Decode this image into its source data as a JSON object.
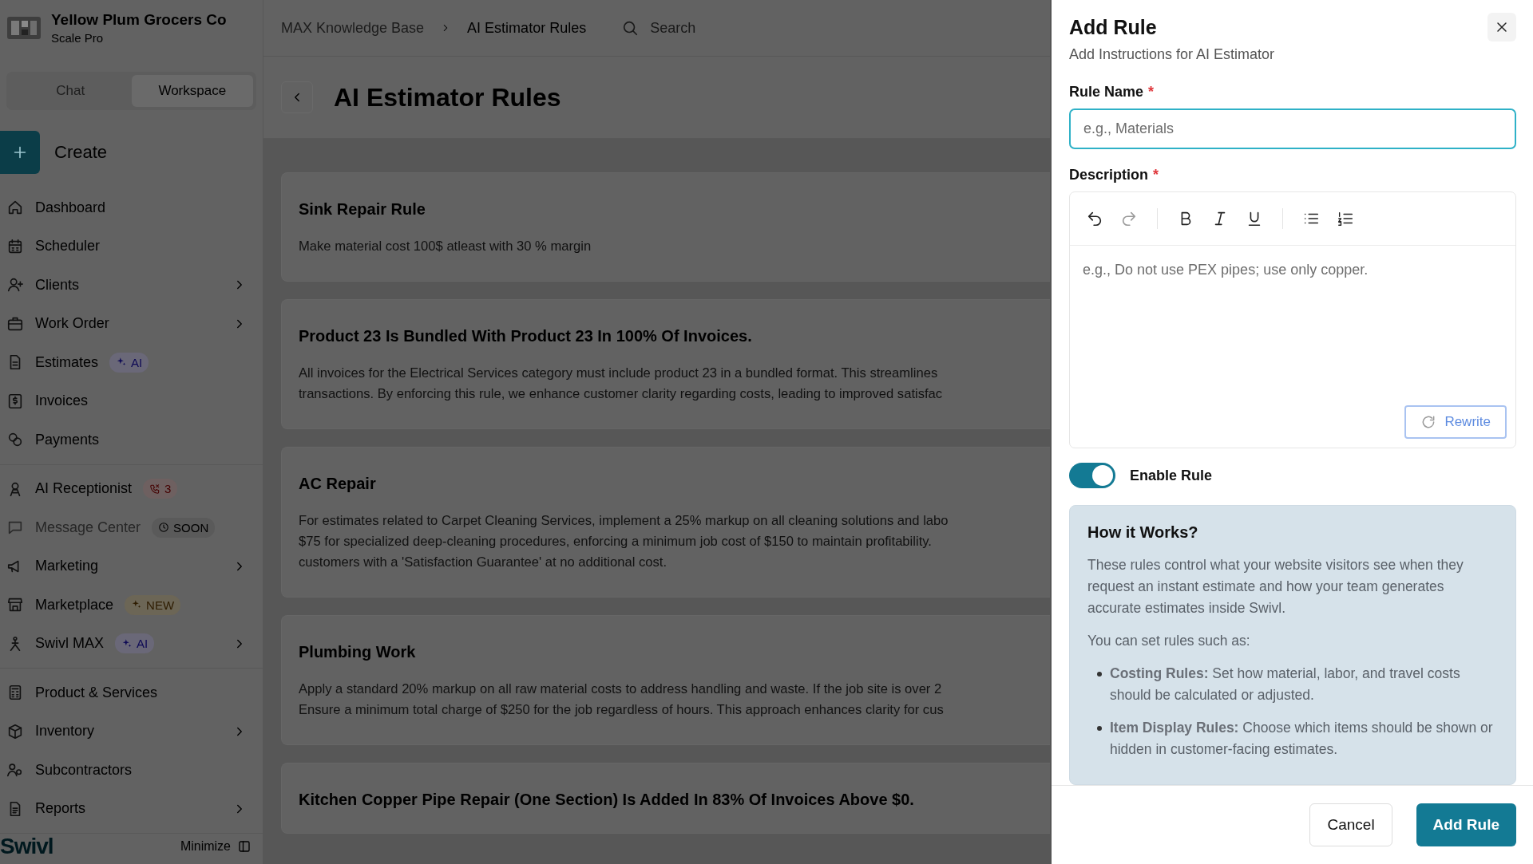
{
  "company": {
    "name": "Yellow Plum Grocers Co",
    "plan": "Scale Pro"
  },
  "mode_tabs": [
    {
      "label": "Chat",
      "selected": false
    },
    {
      "label": "Workspace",
      "selected": true
    }
  ],
  "create_button": {
    "label": "Create"
  },
  "nav_sections": [
    {
      "items": [
        {
          "label": "Dashboard",
          "has_submenu": false,
          "disabled": false
        },
        {
          "label": "Scheduler",
          "has_submenu": false,
          "disabled": false
        },
        {
          "label": "Clients",
          "has_submenu": true,
          "disabled": false
        },
        {
          "label": "Work Order",
          "has_submenu": true,
          "disabled": false
        },
        {
          "label": "Estimates",
          "has_submenu": false,
          "disabled": false,
          "badge": {
            "kind": "ai",
            "text": "AI"
          }
        },
        {
          "label": "Invoices",
          "has_submenu": false,
          "disabled": false
        },
        {
          "label": "Payments",
          "has_submenu": false,
          "disabled": false
        }
      ]
    },
    {
      "items": [
        {
          "label": "AI Receptionist",
          "has_submenu": false,
          "disabled": false,
          "badge": {
            "kind": "calls",
            "text": "3"
          }
        },
        {
          "label": "Message Center",
          "has_submenu": false,
          "disabled": true,
          "badge": {
            "kind": "soon",
            "text": "SOON"
          }
        },
        {
          "label": "Marketing",
          "has_submenu": true,
          "disabled": false
        },
        {
          "label": "Marketplace",
          "has_submenu": false,
          "disabled": false,
          "badge": {
            "kind": "new",
            "text": "NEW"
          }
        },
        {
          "label": "Swivl MAX",
          "has_submenu": true,
          "disabled": false,
          "badge": {
            "kind": "ai",
            "text": "AI"
          }
        }
      ]
    },
    {
      "items": [
        {
          "label": "Product & Services",
          "has_submenu": false,
          "disabled": false
        },
        {
          "label": "Inventory",
          "has_submenu": true,
          "disabled": false
        },
        {
          "label": "Subcontractors",
          "has_submenu": false,
          "disabled": false
        },
        {
          "label": "Reports",
          "has_submenu": true,
          "disabled": false
        }
      ]
    }
  ],
  "sidebar_footer": {
    "logo": "Swivl",
    "minimize": "Minimize"
  },
  "breadcrumbs": [
    "MAX Knowledge Base",
    "AI Estimator Rules"
  ],
  "search": {
    "placeholder": "Search"
  },
  "page_title": "AI Estimator Rules",
  "rules": [
    {
      "title": "Sink Repair Rule",
      "lines": [
        "Make material cost 100$ atleast with 30 % margin"
      ]
    },
    {
      "title": "Product 23 Is Bundled With Product 23 In 100% Of Invoices.",
      "lines": [
        "All invoices for the Electrical Services category must include product 23 in a bundled format. This streamlines",
        "transactions. By enforcing this rule, we enhance customer clarity regarding costs, leading to improved satisfac"
      ]
    },
    {
      "title": "AC Repair",
      "lines": [
        "For estimates related to Carpet Cleaning Services, implement a 25% markup on all cleaning solutions and labo",
        "$75 for specialized deep-cleaning procedures, enforcing a minimum job cost of $150 to maintain profitability.",
        "customers with a 'Satisfaction Guarantee' at no additional cost."
      ]
    },
    {
      "title": "Plumbing Work",
      "lines": [
        "Apply a standard 20% markup on all raw material costs to address handling and waste. If the job site is over 2",
        "Ensure a minimum total charge of $250 for the job regardless of hours. This approach enhances clarity for cus"
      ]
    },
    {
      "title": "Kitchen Copper Pipe Repair (One Section) Is Added In 83% Of Invoices Above $0."
    }
  ],
  "drawer": {
    "title": "Add Rule",
    "subtitle": "Add Instructions for AI Estimator",
    "rule_name": {
      "label": "Rule Name",
      "required_mark": "*",
      "placeholder": "e.g., Materials",
      "focused": true
    },
    "description": {
      "label": "Description",
      "required_mark": "*",
      "placeholder": "e.g., Do not use PEX pipes; use only copper.",
      "toolbar_groups": [
        [
          {
            "kind": "undo",
            "disabled": false
          },
          {
            "kind": "redo",
            "disabled": true
          }
        ],
        [
          {
            "kind": "bold",
            "disabled": false
          },
          {
            "kind": "italic",
            "disabled": false
          },
          {
            "kind": "underline",
            "disabled": false
          }
        ],
        [
          {
            "kind": "bullet-list",
            "disabled": false
          },
          {
            "kind": "ordered-list",
            "disabled": false
          }
        ]
      ],
      "rewrite_button": {
        "label": "Rewrite",
        "disabled": true
      }
    },
    "enable_rule": {
      "label": "Enable Rule",
      "on": true
    },
    "how_it_works": {
      "title": "How it Works?",
      "paragraphs": [
        "These rules control what your website visitors see when they request an instant estimate and how your team generates accurate estimates inside Swivl.",
        "You can set rules such as:"
      ],
      "bullets": [
        "**Costing Rules:** Set how material, labor, and travel costs should be calculated or adjusted.",
        "**Item Display Rules:** Choose which items should be shown or hidden in customer-facing estimates."
      ]
    },
    "cancel_button": "Cancel",
    "submit_button": "Add Rule"
  }
}
